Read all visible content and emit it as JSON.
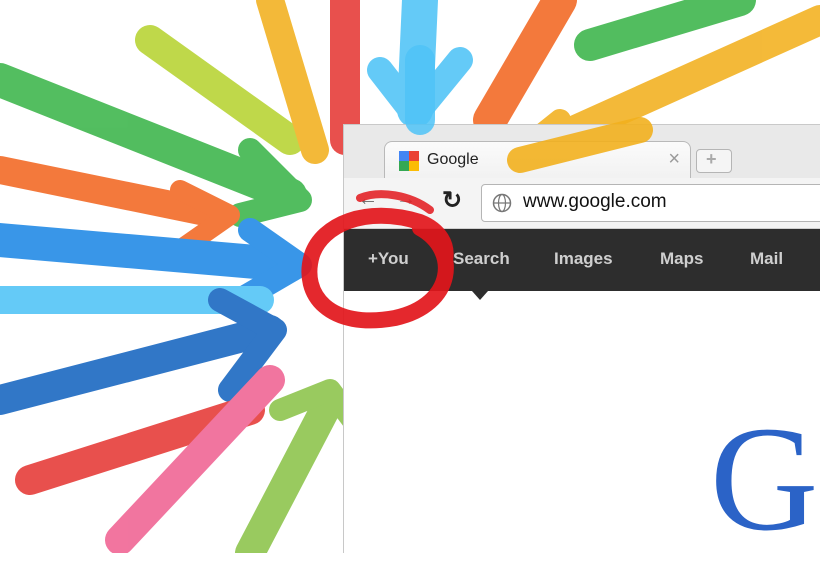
{
  "browser": {
    "tab": {
      "title": "Google",
      "close_glyph": "×"
    },
    "new_tab_glyph": "+",
    "toolbar": {
      "back_glyph": "←",
      "forward_glyph": "→",
      "reload_glyph": "↻",
      "url": "www.google.com"
    }
  },
  "google_bar": {
    "items": [
      {
        "label": "+You"
      },
      {
        "label": "Search"
      },
      {
        "label": "Images"
      },
      {
        "label": "Maps"
      },
      {
        "label": "Mail"
      }
    ]
  },
  "page": {
    "logo_letter": "G"
  },
  "colors": {
    "bar": "#2d2d2d",
    "logo_blue": "#2b63c7",
    "circle_red": "#e2161b",
    "arrow_green": "#3bb54a",
    "arrow_yellow": "#f2b01e",
    "arrow_orange": "#f26722",
    "arrow_blue": "#1e88e5",
    "arrow_cyan": "#4fc3f7",
    "arrow_lime": "#b7d332",
    "arrow_pink": "#f06292"
  }
}
